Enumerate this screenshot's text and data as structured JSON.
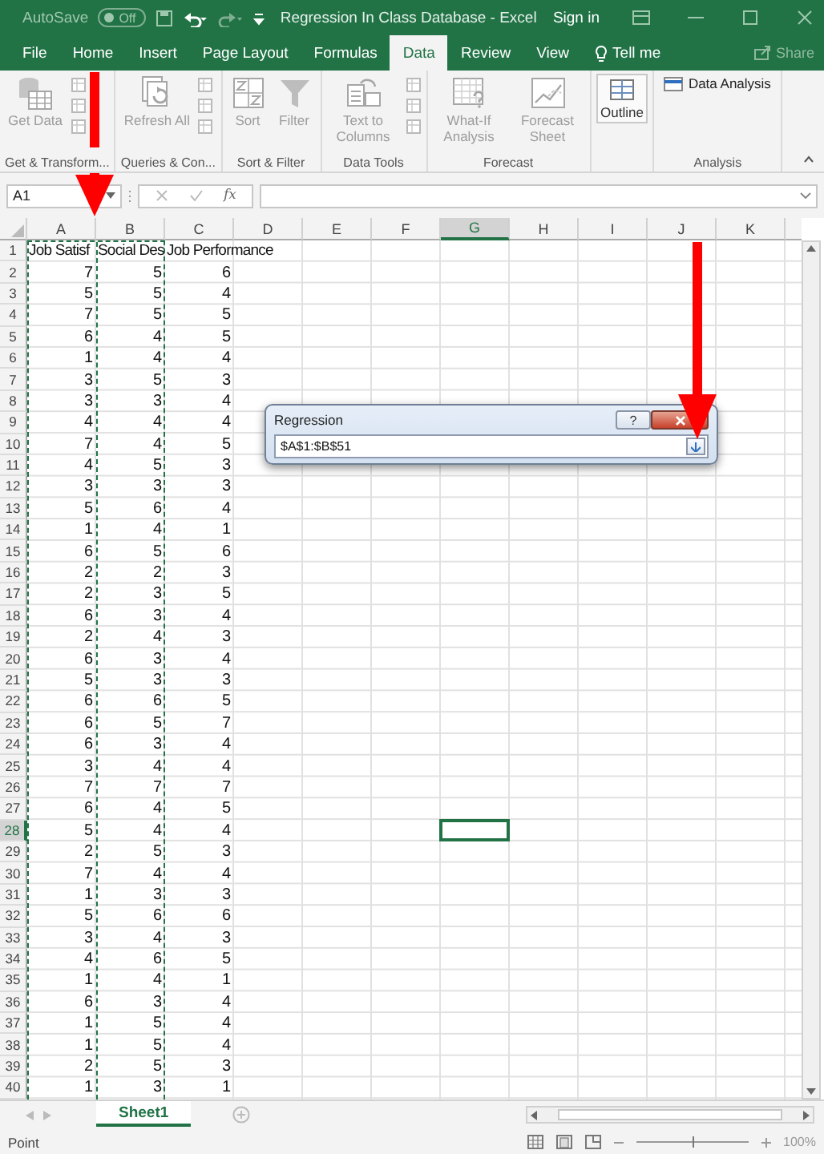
{
  "title_bar": {
    "autosave_label": "AutoSave",
    "autosave_state": "Off",
    "autosave_on": false,
    "title": "Regression In Class Database  -  Excel",
    "sign_in": "Sign in"
  },
  "ribbon_tabs": [
    {
      "label": "File",
      "selected": false
    },
    {
      "label": "Home",
      "selected": false
    },
    {
      "label": "Insert",
      "selected": false
    },
    {
      "label": "Page Layout",
      "selected": false
    },
    {
      "label": "Formulas",
      "selected": false
    },
    {
      "label": "Data",
      "selected": true
    },
    {
      "label": "Review",
      "selected": false
    },
    {
      "label": "View",
      "selected": false
    }
  ],
  "tell_me": "Tell me",
  "share": "Share",
  "ribbon": {
    "disabled": true,
    "groups": [
      {
        "label": "Get & Transform...",
        "buttons": [
          {
            "label": "Get Data",
            "kind": "large"
          }
        ]
      },
      {
        "label": "Queries & Con...",
        "buttons": [
          {
            "label": "Refresh All",
            "kind": "large"
          }
        ]
      },
      {
        "label": "Sort & Filter",
        "buttons": [
          {
            "label": "Sort",
            "kind": "large"
          },
          {
            "label": "Filter",
            "kind": "large"
          }
        ]
      },
      {
        "label": "Data Tools",
        "buttons": [
          {
            "label": "Text to Columns",
            "kind": "large"
          }
        ]
      },
      {
        "label": "Forecast",
        "buttons": [
          {
            "label": "What-If Analysis",
            "kind": "large"
          },
          {
            "label": "Forecast Sheet",
            "kind": "large"
          }
        ]
      },
      {
        "buttons": [
          {
            "label": "Outline",
            "kind": "large"
          }
        ]
      },
      {
        "label": "Analysis",
        "buttons": [
          {
            "label": "Data Analysis",
            "kind": "small"
          }
        ]
      }
    ]
  },
  "formula_bar": {
    "name_box": "A1",
    "insert_function": "fx"
  },
  "sheet": {
    "columns": [
      {
        "label": "A",
        "selected": false
      },
      {
        "label": "B",
        "selected": false
      },
      {
        "label": "C",
        "selected": false
      },
      {
        "label": "D",
        "selected": false
      },
      {
        "label": "E",
        "selected": false
      },
      {
        "label": "F",
        "selected": false
      },
      {
        "label": "G",
        "selected": true
      },
      {
        "label": "H",
        "selected": false
      },
      {
        "label": "I",
        "selected": false
      },
      {
        "label": "J",
        "selected": false
      },
      {
        "label": "K",
        "selected": false
      }
    ],
    "rows": [
      {
        "number": "1",
        "selected": false,
        "cells": [
          "Job Satisf",
          "Social Des",
          "Job Performance"
        ]
      },
      {
        "number": "2",
        "selected": false,
        "cells": [
          "7",
          "5",
          "6"
        ]
      },
      {
        "number": "3",
        "selected": false,
        "cells": [
          "5",
          "5",
          "4"
        ]
      },
      {
        "number": "4",
        "selected": false,
        "cells": [
          "7",
          "5",
          "5"
        ]
      },
      {
        "number": "5",
        "selected": false,
        "cells": [
          "6",
          "4",
          "5"
        ]
      },
      {
        "number": "6",
        "selected": false,
        "cells": [
          "1",
          "4",
          "4"
        ]
      },
      {
        "number": "7",
        "selected": false,
        "cells": [
          "3",
          "5",
          "3"
        ]
      },
      {
        "number": "8",
        "selected": false,
        "cells": [
          "3",
          "3",
          "4"
        ]
      },
      {
        "number": "9",
        "selected": false,
        "cells": [
          "4",
          "4",
          "4"
        ]
      },
      {
        "number": "10",
        "selected": false,
        "cells": [
          "7",
          "4",
          "5"
        ]
      },
      {
        "number": "11",
        "selected": false,
        "cells": [
          "4",
          "5",
          "3"
        ]
      },
      {
        "number": "12",
        "selected": false,
        "cells": [
          "3",
          "3",
          "3"
        ]
      },
      {
        "number": "13",
        "selected": false,
        "cells": [
          "5",
          "6",
          "4"
        ]
      },
      {
        "number": "14",
        "selected": false,
        "cells": [
          "1",
          "4",
          "1"
        ]
      },
      {
        "number": "15",
        "selected": false,
        "cells": [
          "6",
          "5",
          "6"
        ]
      },
      {
        "number": "16",
        "selected": false,
        "cells": [
          "2",
          "2",
          "3"
        ]
      },
      {
        "number": "17",
        "selected": false,
        "cells": [
          "2",
          "3",
          "5"
        ]
      },
      {
        "number": "18",
        "selected": false,
        "cells": [
          "6",
          "3",
          "4"
        ]
      },
      {
        "number": "19",
        "selected": false,
        "cells": [
          "2",
          "4",
          "3"
        ]
      },
      {
        "number": "20",
        "selected": false,
        "cells": [
          "6",
          "3",
          "4"
        ]
      },
      {
        "number": "21",
        "selected": false,
        "cells": [
          "5",
          "3",
          "3"
        ]
      },
      {
        "number": "22",
        "selected": false,
        "cells": [
          "6",
          "6",
          "5"
        ]
      },
      {
        "number": "23",
        "selected": false,
        "cells": [
          "6",
          "5",
          "7"
        ]
      },
      {
        "number": "24",
        "selected": false,
        "cells": [
          "6",
          "3",
          "4"
        ]
      },
      {
        "number": "25",
        "selected": false,
        "cells": [
          "3",
          "4",
          "4"
        ]
      },
      {
        "number": "26",
        "selected": false,
        "cells": [
          "7",
          "7",
          "7"
        ]
      },
      {
        "number": "27",
        "selected": false,
        "cells": [
          "6",
          "4",
          "5"
        ]
      },
      {
        "number": "28",
        "selected": true,
        "cells": [
          "5",
          "4",
          "4"
        ]
      },
      {
        "number": "29",
        "selected": false,
        "cells": [
          "2",
          "5",
          "3"
        ]
      },
      {
        "number": "30",
        "selected": false,
        "cells": [
          "7",
          "4",
          "4"
        ]
      },
      {
        "number": "31",
        "selected": false,
        "cells": [
          "1",
          "3",
          "3"
        ]
      },
      {
        "number": "32",
        "selected": false,
        "cells": [
          "5",
          "6",
          "6"
        ]
      },
      {
        "number": "33",
        "selected": false,
        "cells": [
          "3",
          "4",
          "3"
        ]
      },
      {
        "number": "34",
        "selected": false,
        "cells": [
          "4",
          "6",
          "5"
        ]
      },
      {
        "number": "35",
        "selected": false,
        "cells": [
          "1",
          "4",
          "1"
        ]
      },
      {
        "number": "36",
        "selected": false,
        "cells": [
          "6",
          "3",
          "4"
        ]
      },
      {
        "number": "37",
        "selected": false,
        "cells": [
          "1",
          "5",
          "4"
        ]
      },
      {
        "number": "38",
        "selected": false,
        "cells": [
          "1",
          "5",
          "4"
        ]
      },
      {
        "number": "39",
        "selected": false,
        "cells": [
          "2",
          "5",
          "3"
        ]
      },
      {
        "number": "40",
        "selected": false,
        "cells": [
          "1",
          "3",
          "1"
        ]
      }
    ]
  },
  "dialog": {
    "title": "Regression",
    "help_button": "?",
    "value": "$A$1:$B$51"
  },
  "sheet_tabs": [
    {
      "label": "Sheet1",
      "selected": true
    }
  ],
  "status_bar": {
    "mode": "Point",
    "zoom": {
      "level": 0.5,
      "reading": "100%"
    }
  }
}
